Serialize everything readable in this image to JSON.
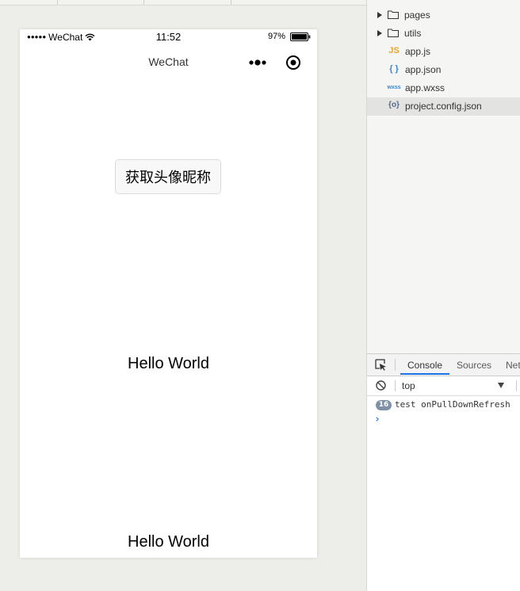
{
  "simulator": {
    "status_bar": {
      "signal": "●●●●●",
      "carrier": "WeChat",
      "time": "11:52",
      "battery": "97%"
    },
    "nav": {
      "title": "WeChat"
    },
    "avatar_button_label": "获取头像昵称",
    "hello_texts": [
      "Hello World",
      "Hello World"
    ]
  },
  "file_tree": {
    "items": [
      {
        "label": "pages",
        "kind": "folder"
      },
      {
        "label": "utils",
        "kind": "folder"
      },
      {
        "label": "app.js",
        "kind": "file",
        "icon": "JS"
      },
      {
        "label": "app.json",
        "kind": "file",
        "icon": "{ }"
      },
      {
        "label": "app.wxss",
        "kind": "file",
        "icon": "wxss"
      },
      {
        "label": "project.config.json",
        "kind": "file",
        "icon": "{o}",
        "selected": true
      }
    ]
  },
  "devtools": {
    "tabs": [
      "Console",
      "Sources",
      "Net"
    ],
    "active_tab": "Console",
    "context": "top",
    "console": {
      "count": "16",
      "message": "test onPullDownRefresh",
      "prompt": "›"
    }
  },
  "colors": {
    "accent": "#1a73e8",
    "js_icon": "#e8a735",
    "json_icon": "#3b87d5",
    "badge": "#8090a6"
  }
}
